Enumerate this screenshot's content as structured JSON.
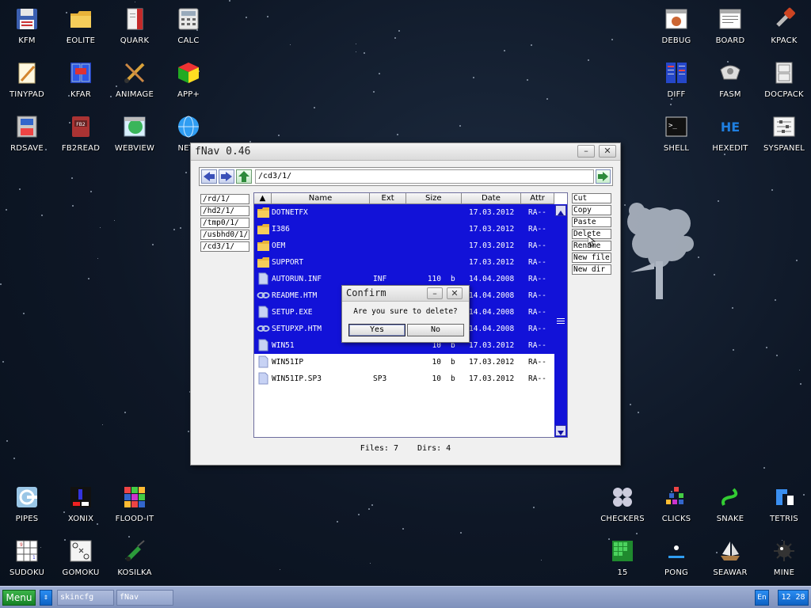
{
  "desktop": {
    "icons_left_top": [
      {
        "label": "KFM",
        "icon": "floppy-disk-icon"
      },
      {
        "label": "EOLITE",
        "icon": "folder-icon"
      },
      {
        "label": "QUARK",
        "icon": "notebook-icon"
      },
      {
        "label": "CALC",
        "icon": "calculator-icon"
      },
      {
        "label": "TINYPAD",
        "icon": "notepad-icon"
      },
      {
        "label": "KFAR",
        "icon": "dual-panel-icon"
      },
      {
        "label": "ANIMAGE",
        "icon": "paint-tools-icon"
      },
      {
        "label": "APP+",
        "icon": "rubik-cube-icon"
      },
      {
        "label": "RDSAVE",
        "icon": "disk-save-icon"
      },
      {
        "label": "FB2READ",
        "icon": "book-icon"
      },
      {
        "label": "WEBVIEW",
        "icon": "globe-map-icon"
      },
      {
        "label": "NETS",
        "icon": "network-globe-icon"
      }
    ],
    "icons_right_top": [
      {
        "label": "DEBUG",
        "icon": "bug-window-icon"
      },
      {
        "label": "BOARD",
        "icon": "board-window-icon"
      },
      {
        "label": "KPACK",
        "icon": "wrench-icon"
      },
      {
        "label": "DIFF",
        "icon": "diff-icon"
      },
      {
        "label": "FASM",
        "icon": "assembler-icon"
      },
      {
        "label": "DOCPACK",
        "icon": "cabinet-icon"
      },
      {
        "label": "SHELL",
        "icon": "terminal-icon"
      },
      {
        "label": "HEXEDIT",
        "icon": "hex-editor-icon"
      },
      {
        "label": "SYSPANEL",
        "icon": "sliders-icon"
      }
    ],
    "icons_left_bottom": [
      {
        "label": "PIPES",
        "icon": "pipes-icon"
      },
      {
        "label": "XONIX",
        "icon": "xonix-icon"
      },
      {
        "label": "FLOOD-IT",
        "icon": "flood-it-icon"
      },
      {
        "label": "SUDOKU",
        "icon": "sudoku-icon"
      },
      {
        "label": "GOMOKU",
        "icon": "gomoku-icon"
      },
      {
        "label": "KOSILKA",
        "icon": "lawnmower-icon"
      }
    ],
    "icons_right_bottom": [
      {
        "label": "CHECKERS",
        "icon": "checkers-icon"
      },
      {
        "label": "CLICKS",
        "icon": "clicks-icon"
      },
      {
        "label": "SNAKE",
        "icon": "snake-icon"
      },
      {
        "label": "TETRIS",
        "icon": "tetris-icon"
      },
      {
        "label": "15",
        "icon": "fifteen-puzzle-icon"
      },
      {
        "label": "PONG",
        "icon": "pong-icon"
      },
      {
        "label": "SEAWAR",
        "icon": "ship-icon"
      },
      {
        "label": "MINE",
        "icon": "mine-icon"
      }
    ]
  },
  "fnav": {
    "title": "fNav 0.46",
    "path": "/cd3/1/",
    "drives": [
      "/rd/1/",
      "/hd2/1/",
      "/tmp0/1/",
      "/usbhd0/1/",
      "/cd3/1/"
    ],
    "columns": {
      "name": "Name",
      "ext": "Ext",
      "size": "Size",
      "date": "Date",
      "attr": "Attr"
    },
    "files": [
      {
        "name": "DOTNETFX",
        "ext": "",
        "size": "",
        "unit": "",
        "date": "17.03.2012",
        "attr": "RA--",
        "type": "folder",
        "selected": true
      },
      {
        "name": "I386",
        "ext": "",
        "size": "",
        "unit": "",
        "date": "17.03.2012",
        "attr": "RA--",
        "type": "folder",
        "selected": true
      },
      {
        "name": "OEM",
        "ext": "",
        "size": "",
        "unit": "",
        "date": "17.03.2012",
        "attr": "RA--",
        "type": "folder",
        "selected": true
      },
      {
        "name": "SUPPORT",
        "ext": "",
        "size": "",
        "unit": "",
        "date": "17.03.2012",
        "attr": "RA--",
        "type": "folder",
        "selected": true
      },
      {
        "name": "AUTORUN.INF",
        "ext": "INF",
        "size": "110",
        "unit": "b",
        "date": "14.04.2008",
        "attr": "RA--",
        "type": "file",
        "selected": true
      },
      {
        "name": "README.HTM",
        "ext": "",
        "size": "",
        "unit": "",
        "date": "14.04.2008",
        "attr": "RA--",
        "type": "html",
        "selected": true
      },
      {
        "name": "SETUP.EXE",
        "ext": "",
        "size": "",
        "unit": "",
        "date": "14.04.2008",
        "attr": "RA--",
        "type": "file",
        "selected": true
      },
      {
        "name": "SETUPXP.HTM",
        "ext": "",
        "size": "",
        "unit": "",
        "date": "14.04.2008",
        "attr": "RA--",
        "type": "html",
        "selected": true
      },
      {
        "name": "WIN51",
        "ext": "",
        "size": "10",
        "unit": "b",
        "date": "17.03.2012",
        "attr": "RA--",
        "type": "file",
        "selected": true
      },
      {
        "name": "WIN51IP",
        "ext": "",
        "size": "10",
        "unit": "b",
        "date": "17.03.2012",
        "attr": "RA--",
        "type": "file",
        "selected": false
      },
      {
        "name": "WIN51IP.SP3",
        "ext": "SP3",
        "size": "10",
        "unit": "b",
        "date": "17.03.2012",
        "attr": "RA--",
        "type": "file",
        "selected": false
      }
    ],
    "actions": [
      "Cut",
      "Copy",
      "Paste",
      "Delete",
      "Rename",
      "New file",
      "New dir"
    ],
    "status": "Files: 7    Dirs: 4"
  },
  "confirm": {
    "title": "Confirm",
    "message": "Are you sure to delete?",
    "yes": "Yes",
    "no": "No"
  },
  "taskbar": {
    "menu": "Menu",
    "tasks": [
      "skincfg",
      "fNav"
    ],
    "lang": "En",
    "clock": "12 28"
  },
  "colors": {
    "selection": "#1212d8",
    "menu_green": "#1f9a30",
    "taskbar": "#8c9dc6"
  }
}
